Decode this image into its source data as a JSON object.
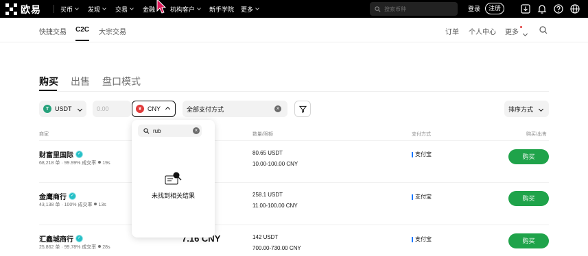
{
  "brand": {
    "name": "欧易"
  },
  "top_nav": {
    "items": [
      {
        "label": "买币"
      },
      {
        "label": "发现"
      },
      {
        "label": "交易"
      },
      {
        "label": "金融"
      },
      {
        "label": "机构客户"
      },
      {
        "label": "新手学院"
      },
      {
        "label": "更多"
      }
    ],
    "search_placeholder": "搜索币种",
    "login_label": "登录",
    "register_label": "注册"
  },
  "sub_nav": {
    "left": [
      {
        "label": "快捷交易"
      },
      {
        "label": "C2C"
      },
      {
        "label": "大宗交易"
      }
    ],
    "right": [
      {
        "label": "订单"
      },
      {
        "label": "个人中心"
      },
      {
        "label": "更多"
      }
    ]
  },
  "tabs": [
    {
      "label": "购买"
    },
    {
      "label": "出售"
    },
    {
      "label": "盘口模式"
    }
  ],
  "filters": {
    "crypto": "USDT",
    "amount_placeholder": "0.00",
    "fiat": "CNY",
    "payment": "全部支付方式",
    "sort": "排序方式"
  },
  "columns": {
    "merchant": "商家",
    "quantity_limit": "数量/限额",
    "payment_method": "支付方式",
    "action": "购买/出售"
  },
  "rows": [
    {
      "name": "财富里国际",
      "orders": "68,218 单",
      "completion": "99.99% 成交率",
      "time": "19s",
      "quantity": "80.65 USDT",
      "limit": "10.00-100.00 CNY",
      "payment": "支付宝",
      "button": "购买"
    },
    {
      "name": "金鹰商行",
      "orders": "43,138 单",
      "completion": "100% 成交率",
      "time": "13s",
      "quantity": "258.1 USDT",
      "limit": "11.00-100.00 CNY",
      "payment": "支付宝",
      "button": "购买"
    },
    {
      "name": "汇鑫城商行",
      "orders": "25,862 单",
      "completion": "99.78% 成交率",
      "time": "28s",
      "price_fragment": "7.16 CNY",
      "quantity": "142 USDT",
      "limit": "700.00-730.00 CNY",
      "payment": "支付宝",
      "button": "购买"
    }
  ],
  "currency_dropdown": {
    "search_value": "rub",
    "empty_message": "未找到相关结果"
  },
  "colors": {
    "buy_green": "#1fa34a",
    "verified_teal": "#26c0c7",
    "cny_red": "#e03a3a",
    "usdt_green": "#26a17b",
    "alipay_blue": "#1677ff"
  }
}
